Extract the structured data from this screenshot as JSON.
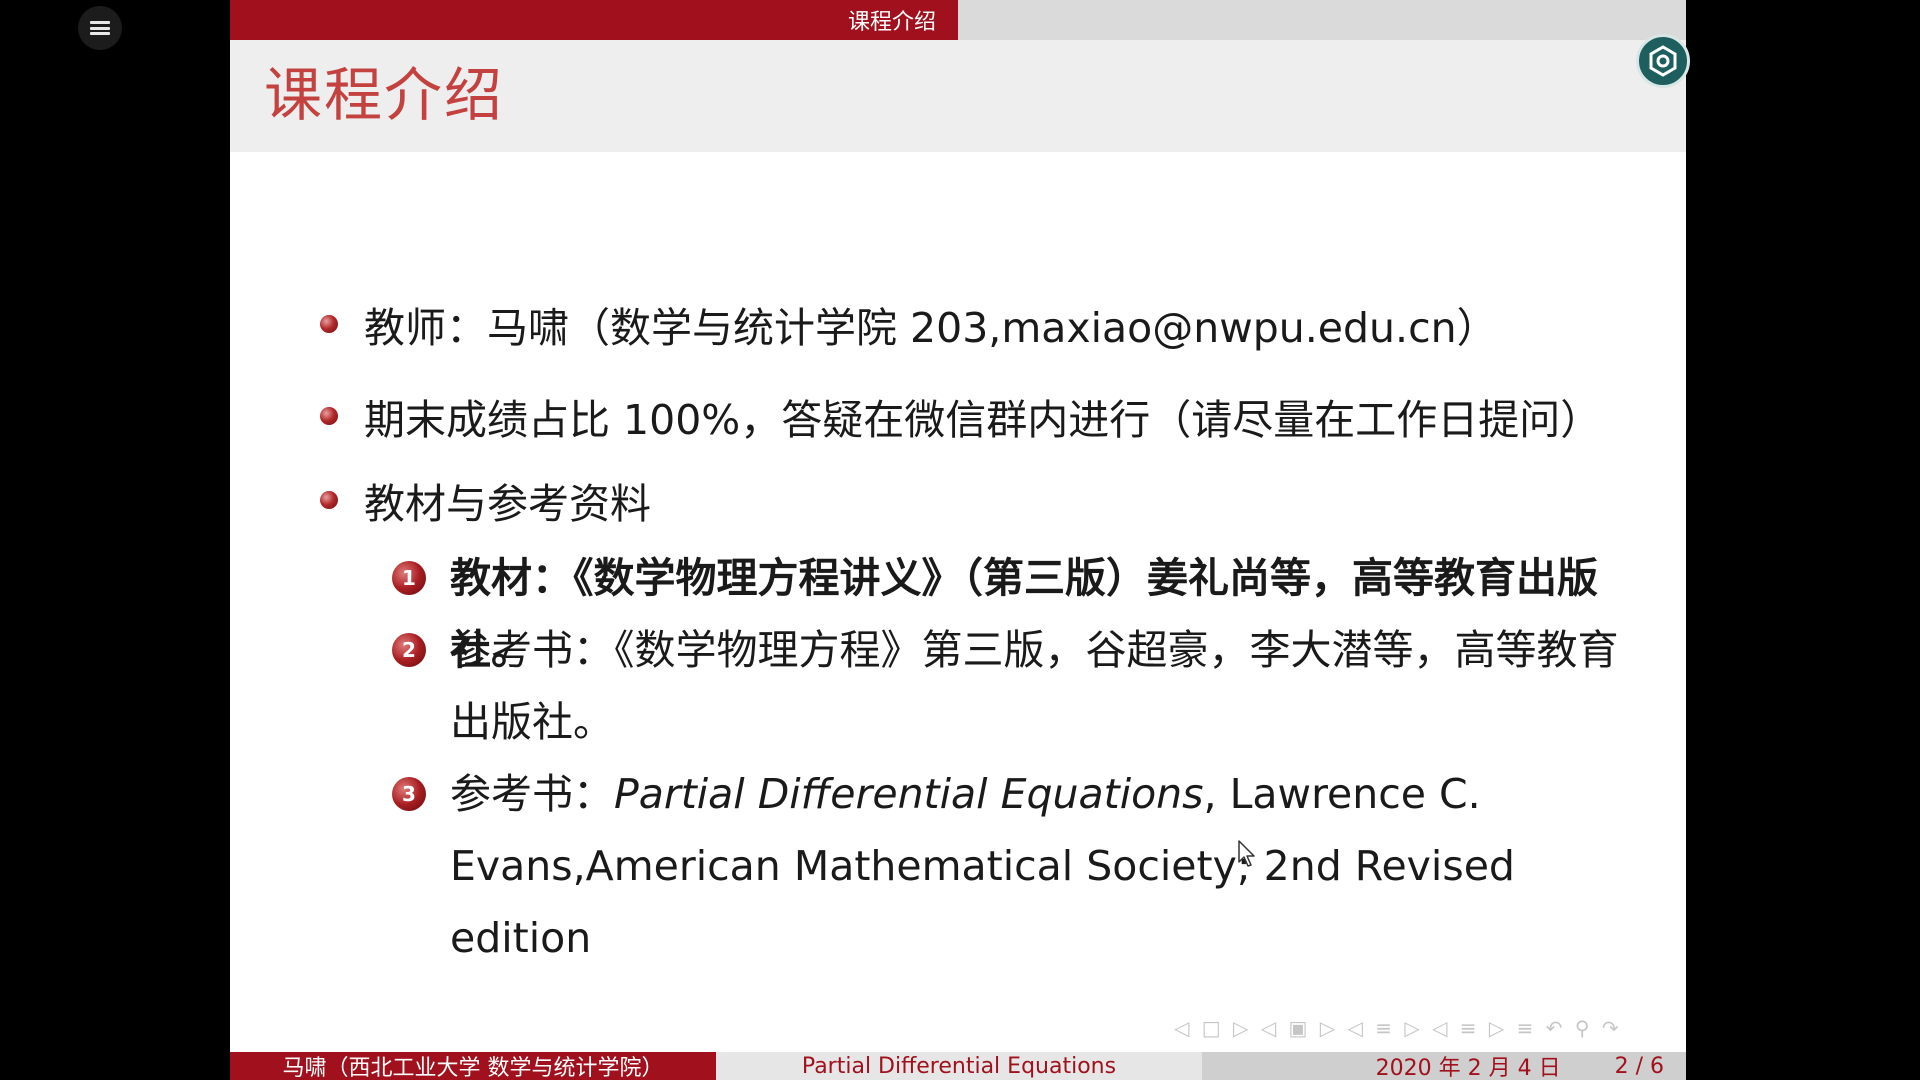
{
  "slide": {
    "section": "课程介绍",
    "title": "课程介绍",
    "bullets": [
      {
        "text": "教师：马啸（数学与统计学院 203,maxiao@nwpu.edu.cn）"
      },
      {
        "text": "期末成绩占比 100%，答疑在微信群内进行（请尽量在工作日提问）"
      },
      {
        "text": "教材与参考资料"
      }
    ],
    "references": [
      {
        "num": "1",
        "text": "教材：《数学物理方程讲义》（第三版）姜礼尚等，高等教育出版社。"
      },
      {
        "num": "2",
        "text": "参考书：《数学物理方程》第三版，谷超豪，李大潜等，高等教育出版社。"
      },
      {
        "num": "3",
        "prefix": "参考书：",
        "title_italic": "Partial Differential Equations",
        "rest": ", Lawrence C. Evans,American Mathematical Society; 2nd Revised edition"
      }
    ],
    "nav_symbols": "◁ □ ▷ ◁ ▣ ▷ ◁ ≡ ▷ ◁ ≡ ▷ ≡ ↶ ⚲ ↷",
    "footer": {
      "author": "马啸（西北工业大学 数学与统计学院）",
      "course": "Partial Differential Equations",
      "date": "2020 年 2 月 4 日",
      "page": "2 / 6"
    }
  },
  "colors": {
    "accent": "#a0111d",
    "title": "#c3413f",
    "float_button": "#1e5e5e"
  },
  "icons": {
    "menu": "hamburger-menu-icon",
    "float": "hexagon-target-icon",
    "cursor": "mouse-pointer-icon"
  }
}
